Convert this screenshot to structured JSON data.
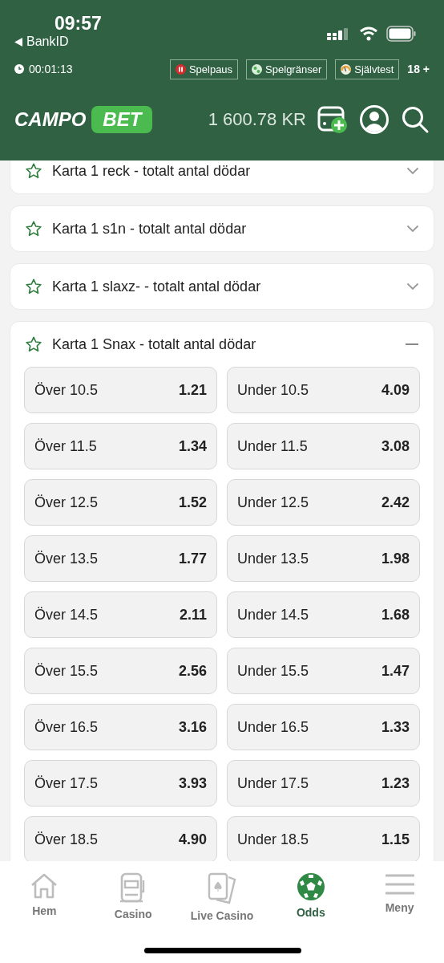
{
  "status_bar": {
    "time": "09:57",
    "back_label": "BankID"
  },
  "info_bar": {
    "session_time": "00:01:13",
    "links": [
      {
        "label": "Spelpaus",
        "kind": "pause"
      },
      {
        "label": "Spelgränser",
        "kind": "limits"
      },
      {
        "label": "Självtest",
        "kind": "test"
      }
    ],
    "age": "18 +"
  },
  "brand": {
    "logo_left": "CAMPO",
    "logo_right": "BET",
    "balance": "1 600.78 KR"
  },
  "markets": [
    {
      "title": "Karta 1 reck - totalt antal dödar",
      "expanded": false
    },
    {
      "title": "Karta 1 s1n - totalt antal dödar",
      "expanded": false
    },
    {
      "title": "Karta 1 slaxz- - totalt antal dödar",
      "expanded": false
    },
    {
      "title": "Karta 1 Snax - totalt antal dödar",
      "expanded": true,
      "outcomes": [
        {
          "label": "Över 10.5",
          "odds": "1.21"
        },
        {
          "label": "Under 10.5",
          "odds": "4.09"
        },
        {
          "label": "Över 11.5",
          "odds": "1.34"
        },
        {
          "label": "Under 11.5",
          "odds": "3.08"
        },
        {
          "label": "Över 12.5",
          "odds": "1.52"
        },
        {
          "label": "Under 12.5",
          "odds": "2.42"
        },
        {
          "label": "Över 13.5",
          "odds": "1.77"
        },
        {
          "label": "Under 13.5",
          "odds": "1.98"
        },
        {
          "label": "Över 14.5",
          "odds": "2.11"
        },
        {
          "label": "Under 14.5",
          "odds": "1.68"
        },
        {
          "label": "Över 15.5",
          "odds": "2.56"
        },
        {
          "label": "Under 15.5",
          "odds": "1.47"
        },
        {
          "label": "Över 16.5",
          "odds": "3.16"
        },
        {
          "label": "Under 16.5",
          "odds": "1.33"
        },
        {
          "label": "Över 17.5",
          "odds": "3.93"
        },
        {
          "label": "Under 17.5",
          "odds": "1.23"
        },
        {
          "label": "Över 18.5",
          "odds": "4.90"
        },
        {
          "label": "Under 18.5",
          "odds": "1.15"
        }
      ]
    }
  ],
  "bottom_nav": [
    {
      "label": "Hem",
      "kind": "home",
      "selected": false
    },
    {
      "label": "Casino",
      "kind": "slot",
      "selected": false
    },
    {
      "label": "Live Casino",
      "kind": "cards",
      "selected": false
    },
    {
      "label": "Odds",
      "kind": "ball",
      "selected": true
    },
    {
      "label": "Meny",
      "kind": "menu",
      "selected": false
    }
  ]
}
